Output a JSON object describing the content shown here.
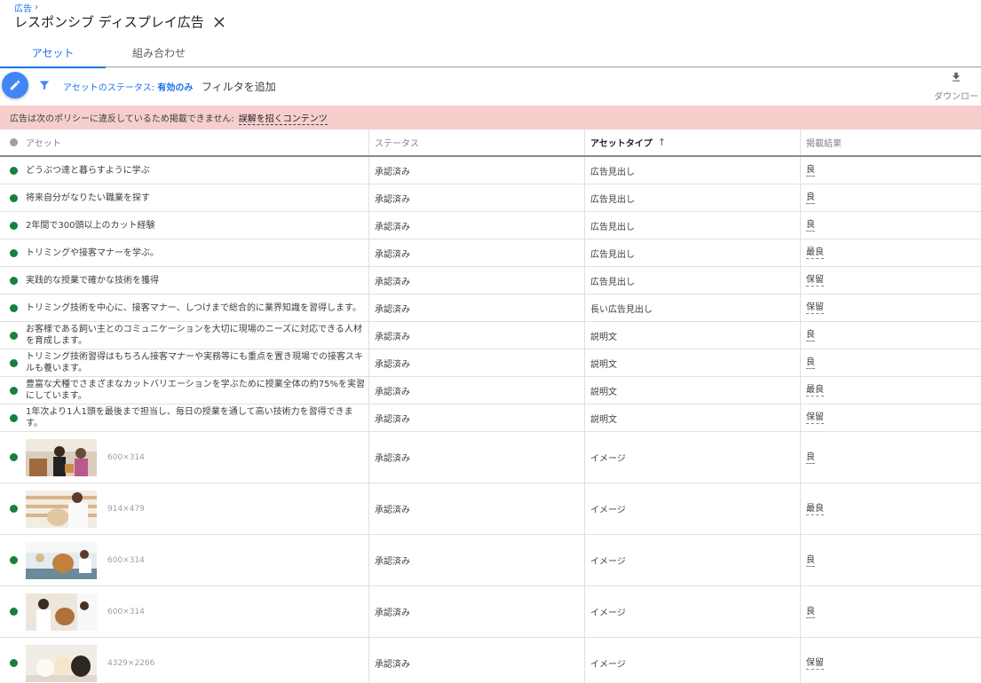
{
  "breadcrumb": {
    "parent": "広告",
    "separator": "›"
  },
  "page_title": "レスポンシブ ディスプレイ広告",
  "tabs": [
    {
      "label": "アセット",
      "active": true
    },
    {
      "label": "組み合わせ",
      "active": false
    }
  ],
  "toolbar": {
    "status_filter_prefix": "アセットのステータス: ",
    "status_filter_value": "有効のみ",
    "add_filter": "フィルタを追加",
    "download": "ダウンロー"
  },
  "alert": {
    "message": "広告は次のポリシーに違反しているため掲載できません:",
    "policy": "誤解を招くコンテンツ"
  },
  "table": {
    "headers": [
      "アセット",
      "ステータス",
      "アセットタイプ",
      "掲載結果"
    ],
    "sort_arrow": "↑",
    "rows": [
      {
        "asset": "どうぶつ達と暮らすように学ぶ",
        "status": "承認済み",
        "type": "広告見出し",
        "perf": "良"
      },
      {
        "asset": "将来自分がなりたい職業を探す",
        "status": "承認済み",
        "type": "広告見出し",
        "perf": "良"
      },
      {
        "asset": "2年間で300頭以上のカット経験",
        "status": "承認済み",
        "type": "広告見出し",
        "perf": "良"
      },
      {
        "asset": "トリミングや接客マナーを学ぶ。",
        "status": "承認済み",
        "type": "広告見出し",
        "perf": "最良"
      },
      {
        "asset": "実践的な授業で確かな技術を獲得",
        "status": "承認済み",
        "type": "広告見出し",
        "perf": "保留"
      },
      {
        "asset": "トリミング技術を中心に、接客マナー、しつけまで総合的に業界知識を習得します。",
        "status": "承認済み",
        "type": "長い広告見出し",
        "perf": "保留"
      },
      {
        "asset": "お客様である飼い主とのコミュニケーションを大切に現場のニーズに対応できる人材を育成します。",
        "status": "承認済み",
        "type": "説明文",
        "perf": "良"
      },
      {
        "asset": "トリミング技術習得はもちろん接客マナーや実務等にも重点を置き現場での接客スキルも養います。",
        "status": "承認済み",
        "type": "説明文",
        "perf": "良"
      },
      {
        "asset": "豊富な犬種でさまざまなカットバリエーションを学ぶために授業全体の約75%を実習にしています。",
        "status": "承認済み",
        "type": "説明文",
        "perf": "最良"
      },
      {
        "asset": "1年次より1人1頭を最後まで担当し、毎日の授業を通して高い技術力を習得できます。",
        "status": "承認済み",
        "type": "説明文",
        "perf": "保留"
      }
    ],
    "image_rows": [
      {
        "dims": "600×314",
        "status": "承認済み",
        "type": "イメージ",
        "perf": "良"
      },
      {
        "dims": "914×479",
        "status": "承認済み",
        "type": "イメージ",
        "perf": "最良"
      },
      {
        "dims": "600×314",
        "status": "承認済み",
        "type": "イメージ",
        "perf": "良"
      },
      {
        "dims": "600×314",
        "status": "承認済み",
        "type": "イメージ",
        "perf": "良"
      },
      {
        "dims": "4329×2266",
        "status": "承認済み",
        "type": "イメージ",
        "perf": "保留"
      }
    ]
  },
  "colors": {
    "accent": "#1a73e8",
    "fab": "#4285f4",
    "alert_bg": "#f6cfcd",
    "status_green": "#188038"
  }
}
